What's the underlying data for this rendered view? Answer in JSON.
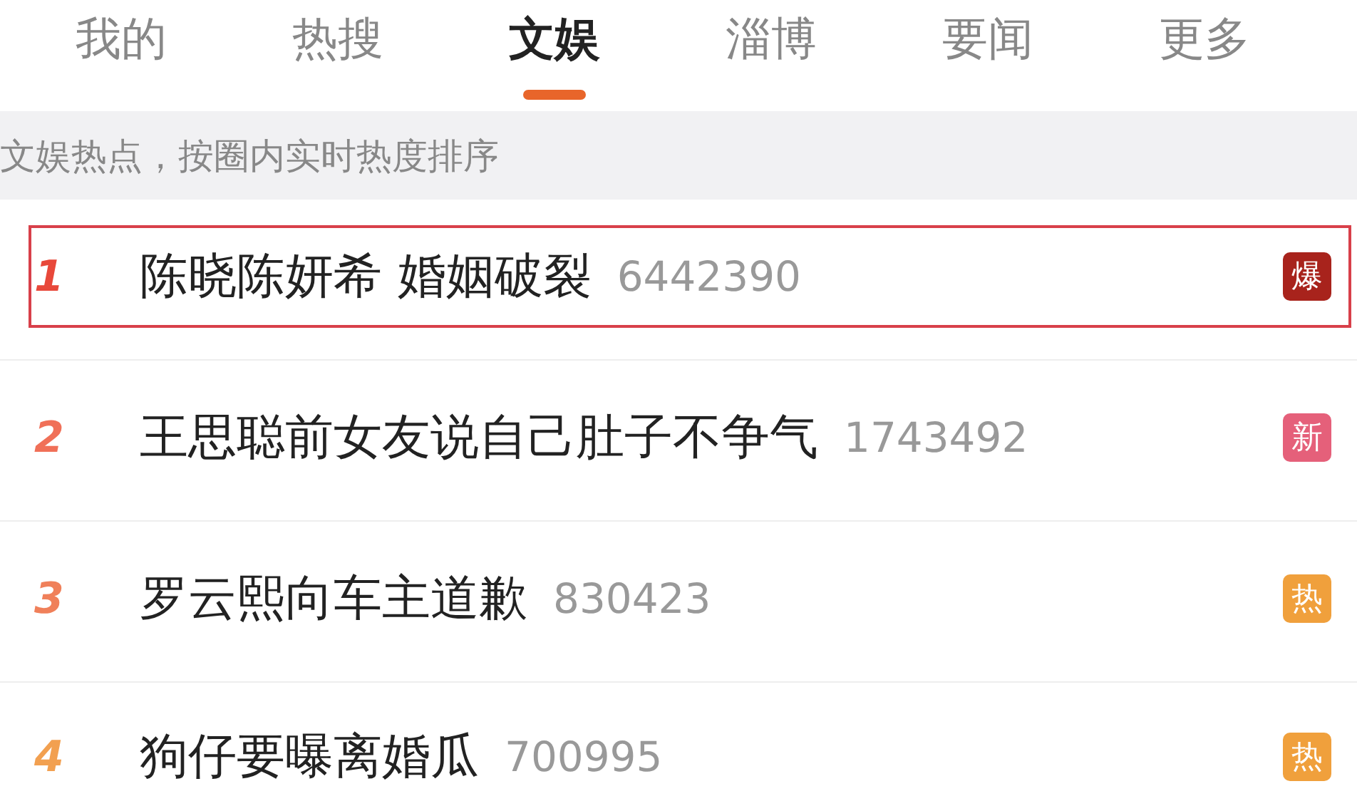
{
  "tabs": [
    {
      "label": "我的",
      "selected": false
    },
    {
      "label": "热搜",
      "selected": false
    },
    {
      "label": "文娱",
      "selected": true
    },
    {
      "label": "淄博",
      "selected": false
    },
    {
      "label": "要闻",
      "selected": false
    },
    {
      "label": "更多",
      "selected": false
    }
  ],
  "subtitle": "文娱热点，按圈内实时热度排序",
  "rows": [
    {
      "rank": "1",
      "title": "陈晓陈妍希 婚姻破裂",
      "count": "6442390",
      "badge": {
        "label": "爆",
        "color": "#a8231c"
      },
      "highlighted": true
    },
    {
      "rank": "2",
      "title": "王思聪前女友说自己肚子不争气",
      "count": "1743492",
      "badge": {
        "label": "新",
        "color": "#e5607a"
      },
      "highlighted": false
    },
    {
      "rank": "3",
      "title": "罗云熙向车主道歉",
      "count": "830423",
      "badge": {
        "label": "热",
        "color": "#f0a03c"
      },
      "highlighted": false
    },
    {
      "rank": "4",
      "title": "狗仔要曝离婚瓜",
      "count": "700995",
      "badge": {
        "label": "热",
        "color": "#f0a03c"
      },
      "highlighted": false
    }
  ]
}
